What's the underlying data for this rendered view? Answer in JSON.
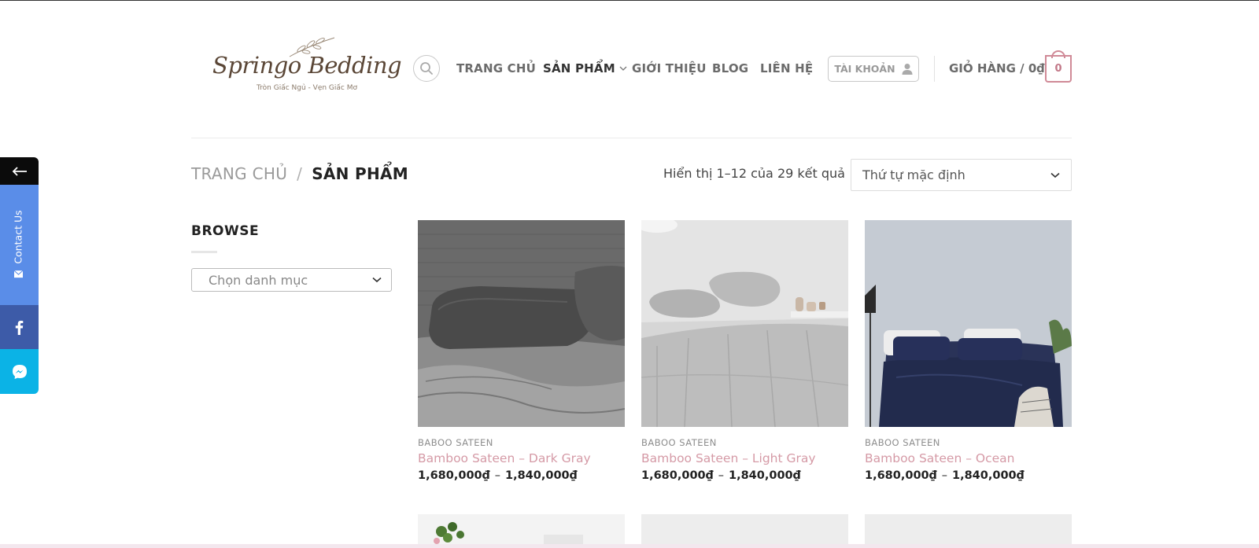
{
  "header": {
    "logo": {
      "title": "Springo Bedding",
      "tagline": "Tròn Giấc Ngủ - Vẹn Giấc Mơ"
    },
    "nav": [
      {
        "label": "TRANG CHỦ"
      },
      {
        "label": "SẢN PHẨM",
        "has_dropdown": true,
        "active": true
      },
      {
        "label": "GIỚI THIỆU"
      },
      {
        "label": "BLOG"
      },
      {
        "label": "LIÊN HỆ"
      }
    ],
    "account_label": "TÀI KHOẢN",
    "cart_label": "GIỎ HÀNG / 0₫",
    "cart_count": "0"
  },
  "breadcrumb": {
    "home": "TRANG CHỦ",
    "separator": "/",
    "current": "SẢN PHẨM"
  },
  "toolbar": {
    "result_count": "Hiển thị 1–12 của 29 kết quả",
    "sort_selected": "Thứ tự mặc định"
  },
  "sidebar": {
    "title": "BROWSE",
    "category_placeholder": "Chọn danh mục"
  },
  "products": [
    {
      "category": "BABOO SATEEN",
      "name": "Bamboo Sateen – Dark Gray",
      "price_min": "1,680,000₫",
      "price_max": "1,840,000₫",
      "price_sep": "–"
    },
    {
      "category": "BABOO SATEEN",
      "name": "Bamboo Sateen – Light Gray",
      "price_min": "1,680,000₫",
      "price_max": "1,840,000₫",
      "price_sep": "–"
    },
    {
      "category": "BABOO SATEEN",
      "name": "Bamboo Sateen – Ocean",
      "price_min": "1,680,000₫",
      "price_max": "1,840,000₫",
      "price_sep": "–"
    }
  ],
  "floating_bar": {
    "contact_label": "Contact Us",
    "icons": [
      "arrow-left-icon",
      "mail-icon",
      "facebook-icon",
      "messenger-icon"
    ]
  },
  "colors": {
    "accent_pink": "#d59aa6",
    "contact_blue": "#5a8de8",
    "facebook_blue": "#3d5ba8",
    "messenger_cyan": "#0bb3e6"
  }
}
